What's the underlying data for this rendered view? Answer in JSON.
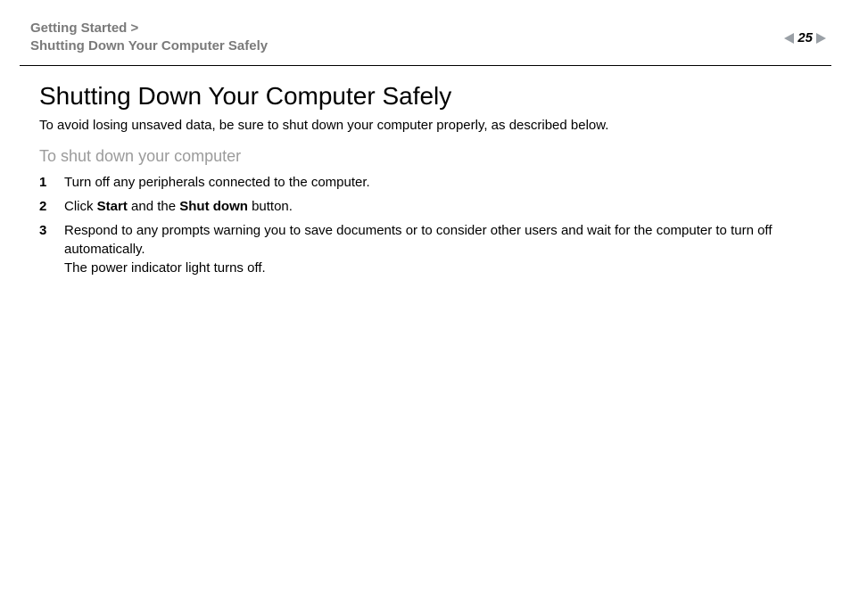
{
  "header": {
    "breadcrumb_section": "Getting Started >",
    "breadcrumb_page": "Shutting Down Your Computer Safely",
    "page_number": "25"
  },
  "main": {
    "title": "Shutting Down Your Computer Safely",
    "lead": "To avoid losing unsaved data, be sure to shut down your computer properly, as described below.",
    "subhead": "To shut down your computer",
    "steps": [
      {
        "num": "1",
        "text": "Turn off any peripherals connected to the computer."
      },
      {
        "num": "2",
        "pre": "Click ",
        "bold1": "Start",
        "mid": " and the ",
        "bold2": "Shut down",
        "post": " button."
      },
      {
        "num": "3",
        "line1": "Respond to any prompts warning you to save documents or to consider other users and wait for the computer to turn off automatically.",
        "line2": "The power indicator light turns off."
      }
    ]
  }
}
